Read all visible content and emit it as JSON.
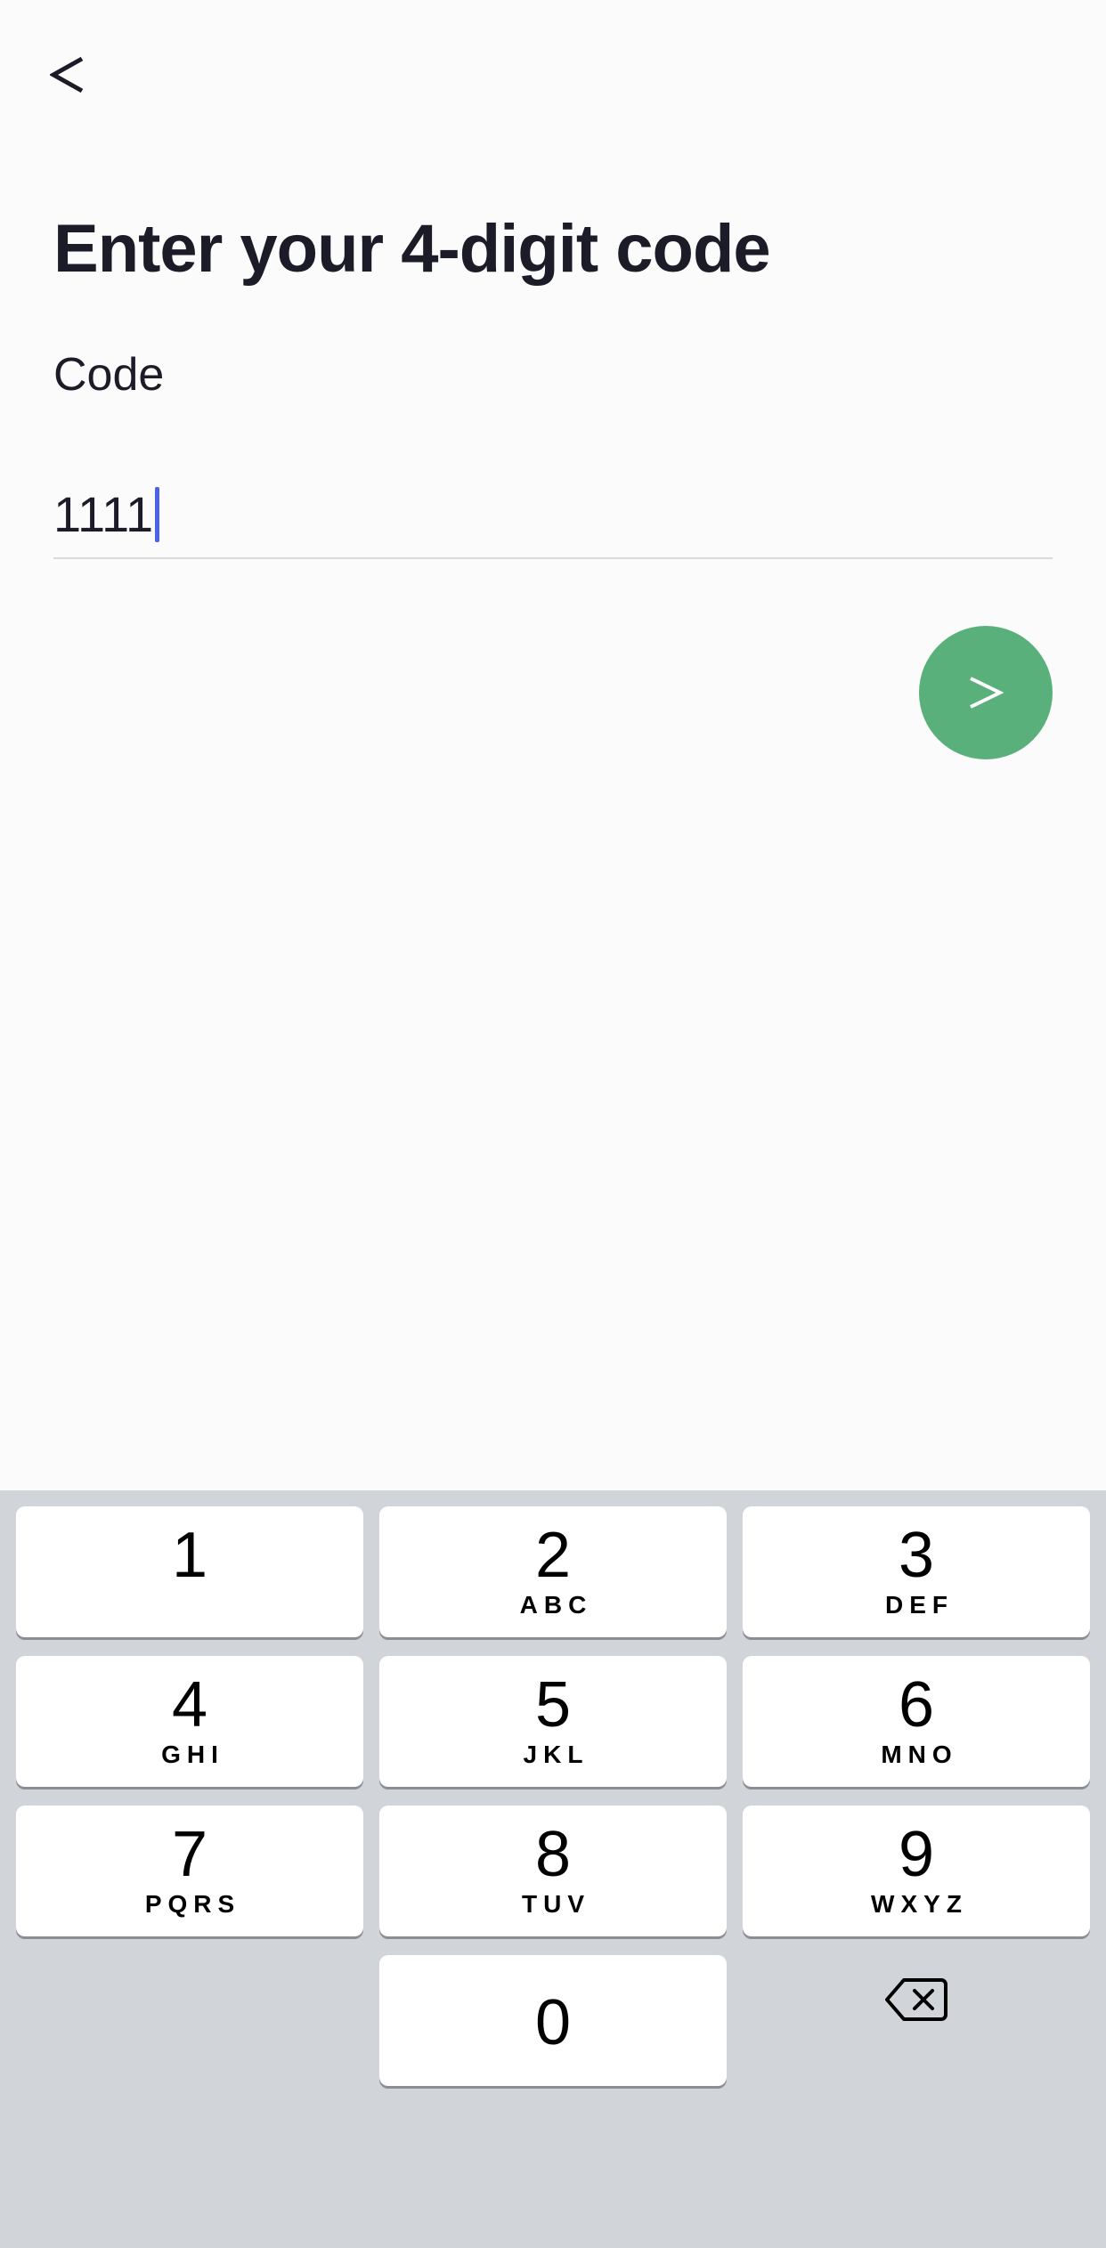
{
  "header": {
    "back_icon": "chevron-left-icon",
    "title": "Enter your 4-digit code"
  },
  "form": {
    "code_label": "Code",
    "code_value": "1111",
    "submit_icon": "chevron-right-icon"
  },
  "colors": {
    "submit_button": "#5ab07a",
    "caret": "#4a63e8",
    "keyboard_background": "#d1d4d9"
  },
  "keyboard": {
    "keys": [
      {
        "digit": "1",
        "letters": ""
      },
      {
        "digit": "2",
        "letters": "ABC"
      },
      {
        "digit": "3",
        "letters": "DEF"
      },
      {
        "digit": "4",
        "letters": "GHI"
      },
      {
        "digit": "5",
        "letters": "JKL"
      },
      {
        "digit": "6",
        "letters": "MNO"
      },
      {
        "digit": "7",
        "letters": "PQRS"
      },
      {
        "digit": "8",
        "letters": "TUV"
      },
      {
        "digit": "9",
        "letters": "WXYZ"
      },
      {
        "digit": "0",
        "letters": ""
      }
    ],
    "delete_icon": "backspace-icon"
  }
}
